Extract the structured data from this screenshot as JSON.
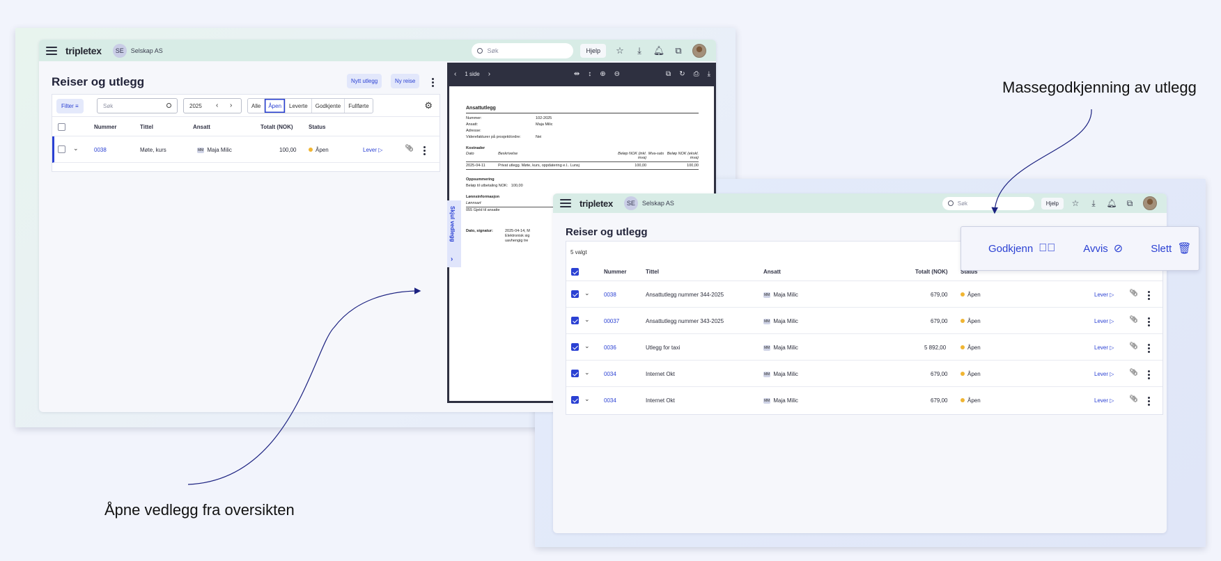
{
  "annotations": {
    "bulk_approval": "Massegodkjenning av utlegg",
    "open_attachment": "Åpne vedlegg fra oversikten"
  },
  "header": {
    "logo": "tripletex",
    "company_initials": "SE",
    "company_name": "Selskap AS",
    "search_placeholder": "Søk",
    "help_label": "Hjelp"
  },
  "screen1": {
    "title": "Reiser og utlegg",
    "new_expense_label": "Nytt utlegg",
    "new_trip_label": "Ny reise",
    "filter_label": "Filter",
    "search_placeholder": "Søk",
    "year": "2025",
    "tabs": [
      "Alle",
      "Åpen",
      "Leverte",
      "Godkjente",
      "Fullførte"
    ],
    "active_tab": "Åpen",
    "columns": [
      "Nummer",
      "Tittel",
      "Ansatt",
      "Totalt (NOK)",
      "Status"
    ],
    "row": {
      "number": "0038",
      "title": "Møte, kurs",
      "employee_initials": "MM",
      "employee": "Maja Milic",
      "total": "100,00",
      "status": "Åpen",
      "deliver_label": "Lever"
    },
    "side_tab_label": "Skjul vedlegg"
  },
  "viewer": {
    "page_label": "1 side",
    "doc": {
      "title": "Ansattutlegg",
      "fields": [
        {
          "k": "Nummer:",
          "v": "102-2025"
        },
        {
          "k": "Ansatt:",
          "v": "Maja Milic"
        },
        {
          "k": "Adresse:",
          "v": ""
        },
        {
          "k": "Viderefakturer på prosjekt/ordre:",
          "v": "Nei"
        }
      ],
      "costs_heading": "Kostnader",
      "cost_cols": [
        "Dato",
        "Beskrivelse",
        "Beløp NOK (inkl. mva)",
        "Mva-sats",
        "Beløp NOK (ekskl. mva)"
      ],
      "cost_row": [
        "2025-04-11",
        "Privat utlegg. Møte, kurs, oppdatering e.l.. Lunsj",
        "100,00",
        "",
        "100,00"
      ],
      "summary_heading": "Oppsummering",
      "summary_line": "Beløp til utbetaling NOK:   100,00",
      "salary_heading": "Lønnsinformasjon",
      "salary_type": "Lønnsart",
      "salary_line": "055 Gjeld til ansatte",
      "signature_label": "Dato, signatur:",
      "signature_lines": [
        "2025-04-14, M",
        "Elektronisk sig",
        "uavhengig tre"
      ]
    }
  },
  "screen2": {
    "title": "Reiser og utlegg",
    "selected_count": "5 valgt",
    "columns": [
      "Nummer",
      "Tittel",
      "Ansatt",
      "Totalt (NOK)",
      "Status"
    ],
    "rows": [
      {
        "number": "0038",
        "title": "Ansattutlegg nummer 344-2025",
        "employee_initials": "MM",
        "employee": "Maja Milic",
        "total": "679,00",
        "status": "Åpen",
        "deliver_label": "Lever"
      },
      {
        "number": "00037",
        "title": "Ansattutlegg nummer 343-2025",
        "employee_initials": "MM",
        "employee": "Maja Milic",
        "total": "679,00",
        "status": "Åpen",
        "deliver_label": "Lever"
      },
      {
        "number": "0036",
        "title": "Utlegg for taxi",
        "employee_initials": "MM",
        "employee": "Maja Milic",
        "total": "5 892,00",
        "status": "Åpen",
        "deliver_label": "Lever"
      },
      {
        "number": "0034",
        "title": "Internet Okt",
        "employee_initials": "MM",
        "employee": "Maja Milic",
        "total": "679,00",
        "status": "Åpen",
        "deliver_label": "Lever"
      },
      {
        "number": "0034",
        "title": "Internet Okt",
        "employee_initials": "MM",
        "employee": "Maja Milic",
        "total": "679,00",
        "status": "Åpen",
        "deliver_label": "Lever"
      }
    ],
    "bulk_actions": {
      "approve": "Godkjenn",
      "reject": "Avvis",
      "delete": "Slett"
    }
  },
  "colors": {
    "accent": "#2b41d3",
    "topbar": "#d8ece6",
    "status_open": "#f0b533"
  }
}
